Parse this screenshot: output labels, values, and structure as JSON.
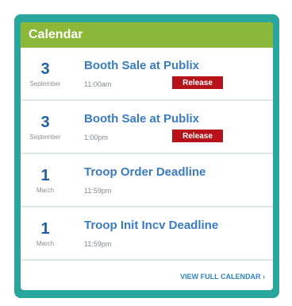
{
  "header": {
    "title": "Calendar"
  },
  "events": [
    {
      "day": "3",
      "month": "September",
      "title": "Booth Sale at Publix",
      "time": "11:00am",
      "badge": "Release"
    },
    {
      "day": "3",
      "month": "September",
      "title": "Booth Sale at Publix",
      "time": "1:00pm",
      "badge": "Release"
    },
    {
      "day": "1",
      "month": "March",
      "title": "Troop Order Deadline",
      "time": "11:59pm"
    },
    {
      "day": "1",
      "month": "March",
      "title": "Troop Init Incv Deadline",
      "time": "11:59pm"
    }
  ],
  "footer": {
    "link_label": "VIEW FULL CALENDAR ›"
  },
  "colors": {
    "frame": "#2aa79c",
    "header": "#8cb83a",
    "day": "#235fa3",
    "title": "#3a7bc3",
    "badge": "#b6131b",
    "link": "#2f86c7"
  }
}
